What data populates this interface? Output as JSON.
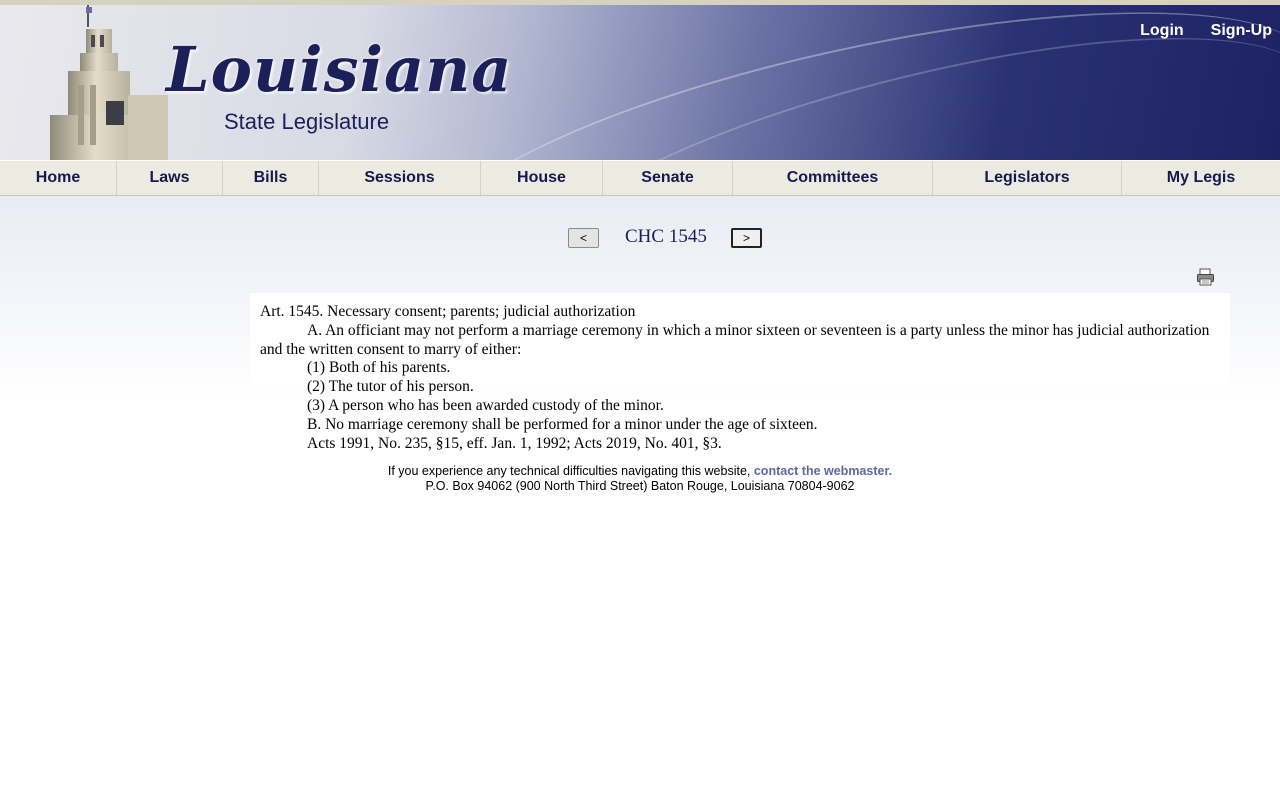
{
  "header": {
    "logo_title": "Louisiana",
    "logo_subtitle": "State Legislature",
    "login_label": "Login",
    "signup_label": "Sign-Up"
  },
  "nav": {
    "items": [
      {
        "label": "Home"
      },
      {
        "label": "Laws"
      },
      {
        "label": "Bills"
      },
      {
        "label": "Sessions"
      },
      {
        "label": "House"
      },
      {
        "label": "Senate"
      },
      {
        "label": "Committees"
      },
      {
        "label": "Legislators"
      },
      {
        "label": "My Legis"
      }
    ]
  },
  "pager": {
    "prev_label": "<",
    "title": "CHC 1545",
    "next_label": ">"
  },
  "print_icon": "printer-icon",
  "law": {
    "heading": "Art. 1545. Necessary consent; parents; judicial authorization",
    "para_a": "A. An officiant may not perform a marriage ceremony in which a minor sixteen or seventeen is a party unless the minor has judicial authorization and the written consent to marry of either:",
    "item1": "(1) Both of his parents.",
    "item2": "(2) The tutor of his person.",
    "item3": "(3) A person who has been awarded custody of the minor.",
    "para_b": "B. No marriage ceremony shall be performed for a minor under the age of sixteen.",
    "history": "Acts 1991, No. 235, §15, eff. Jan. 1, 1992; Acts 2019, No. 401, §3."
  },
  "footer": {
    "line1_text": "If you experience any technical difficulties navigating this website,",
    "webmaster_link": "contact the webmaster.",
    "address": "P.O. Box 94062 (900 North Third Street) Baton Rouge, Louisiana 70804-9062"
  }
}
